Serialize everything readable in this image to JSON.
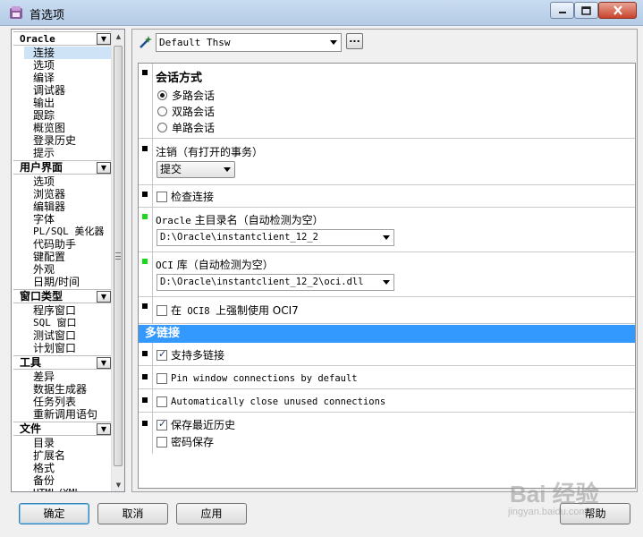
{
  "window": {
    "title": "首选项"
  },
  "colors": {
    "selection": "#3399ff",
    "titlebar": "#c9dcf1",
    "close_button": "#c8442c",
    "indicator_green": "#1ad81a"
  },
  "sidebar": {
    "categories": [
      {
        "label": "Oracle",
        "items": [
          "连接",
          "选项",
          "编译",
          "调试器",
          "输出",
          "跟踪",
          "概览图",
          "登录历史",
          "提示"
        ]
      },
      {
        "label": "用户界面",
        "items": [
          "选项",
          "浏览器",
          "编辑器",
          "字体",
          "PL/SQL 美化器",
          "代码助手",
          "键配置",
          "外观",
          "日期/时间"
        ]
      },
      {
        "label": "窗口类型",
        "items": [
          "程序窗口",
          "SQL 窗口",
          "测试窗口",
          "计划窗口"
        ]
      },
      {
        "label": "工具",
        "items": [
          "差异",
          "数据生成器",
          "任务列表",
          "重新调用语句"
        ]
      },
      {
        "label": "文件",
        "items": [
          "目录",
          "扩展名",
          "格式",
          "备份",
          "HTML/XML"
        ]
      }
    ],
    "selected": "连接"
  },
  "profile": {
    "value": "Default Thsw",
    "more_label": "..."
  },
  "options": {
    "session_mode": {
      "title": "会话方式",
      "choices": [
        "多路会话",
        "双路会话",
        "单路会话"
      ],
      "selected_index": 0
    },
    "logoff": {
      "label": "注销（有打开的事务）",
      "value": "提交"
    },
    "check_connection": {
      "label": "检查连接",
      "checked": false
    },
    "oracle_home": {
      "label_prefix": "Oracle",
      "label_suffix": " 主目录名（自动检测为空）",
      "value": "D:\\Oracle\\instantclient_12_2"
    },
    "oci_library": {
      "label_prefix": "OCI",
      "label_suffix": " 库（自动检测为空）",
      "value": "D:\\Oracle\\instantclient_12_2\\oci.dll"
    },
    "force_oci7": {
      "label_prefix": "在",
      "label_mid": " OCI8 ",
      "label_suffix": "上强制使用 OCI7",
      "checked": false
    },
    "multi_connection": {
      "header": "多链接",
      "support": {
        "label": "支持多链接",
        "checked": true
      },
      "pin_window": {
        "label": "Pin window connections by default",
        "checked": false
      },
      "auto_close": {
        "label": "Automatically close unused connections",
        "checked": false
      },
      "save_history": {
        "label": "保存最近历史",
        "checked": true
      },
      "store_password": {
        "label": "密码保存",
        "checked": false
      }
    }
  },
  "buttons": {
    "ok": "确定",
    "cancel": "取消",
    "apply": "应用",
    "help": "帮助"
  },
  "watermark": {
    "main": "Bai 经验",
    "sub": "jingyan.baidu.com"
  }
}
